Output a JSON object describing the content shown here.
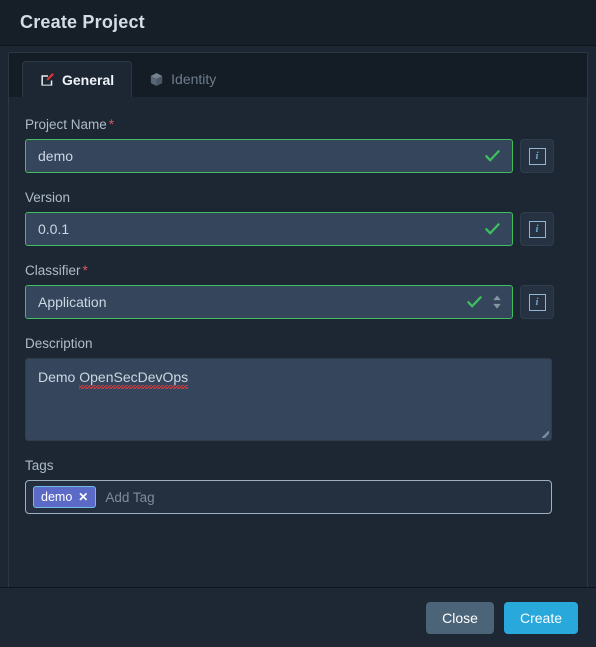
{
  "dialog": {
    "title": "Create Project"
  },
  "tabs": [
    {
      "label": "General",
      "icon": "edit-pencil-icon",
      "active": true
    },
    {
      "label": "Identity",
      "icon": "cube-icon",
      "active": false
    }
  ],
  "form": {
    "project_name": {
      "label": "Project Name",
      "required": "*",
      "value": "demo",
      "valid": true,
      "info_glyph": "i"
    },
    "version": {
      "label": "Version",
      "required": "",
      "value": "0.0.1",
      "valid": true,
      "info_glyph": "i"
    },
    "classifier": {
      "label": "Classifier",
      "required": "*",
      "value": "Application",
      "valid": true,
      "info_glyph": "i"
    },
    "description": {
      "label": "Description",
      "value_plain": "Demo ",
      "value_misspelled": "OpenSecDevOps"
    },
    "tags": {
      "label": "Tags",
      "chips": [
        {
          "label": "demo",
          "remove": "✕"
        }
      ],
      "placeholder": "Add Tag"
    }
  },
  "footer": {
    "close_label": "Close",
    "create_label": "Create"
  },
  "colors": {
    "accent_create": "#29a8dc",
    "close_button": "#4c6478",
    "valid_border": "#3fbf60",
    "required_star": "#e05260",
    "tag_chip_bg": "#5b6ac6",
    "tag_chip_border": "#6fbce8",
    "input_bg": "#34455c",
    "dialog_bg": "#1d2733",
    "header_bg": "#161e28",
    "spell_underline": "#e03a3a"
  }
}
